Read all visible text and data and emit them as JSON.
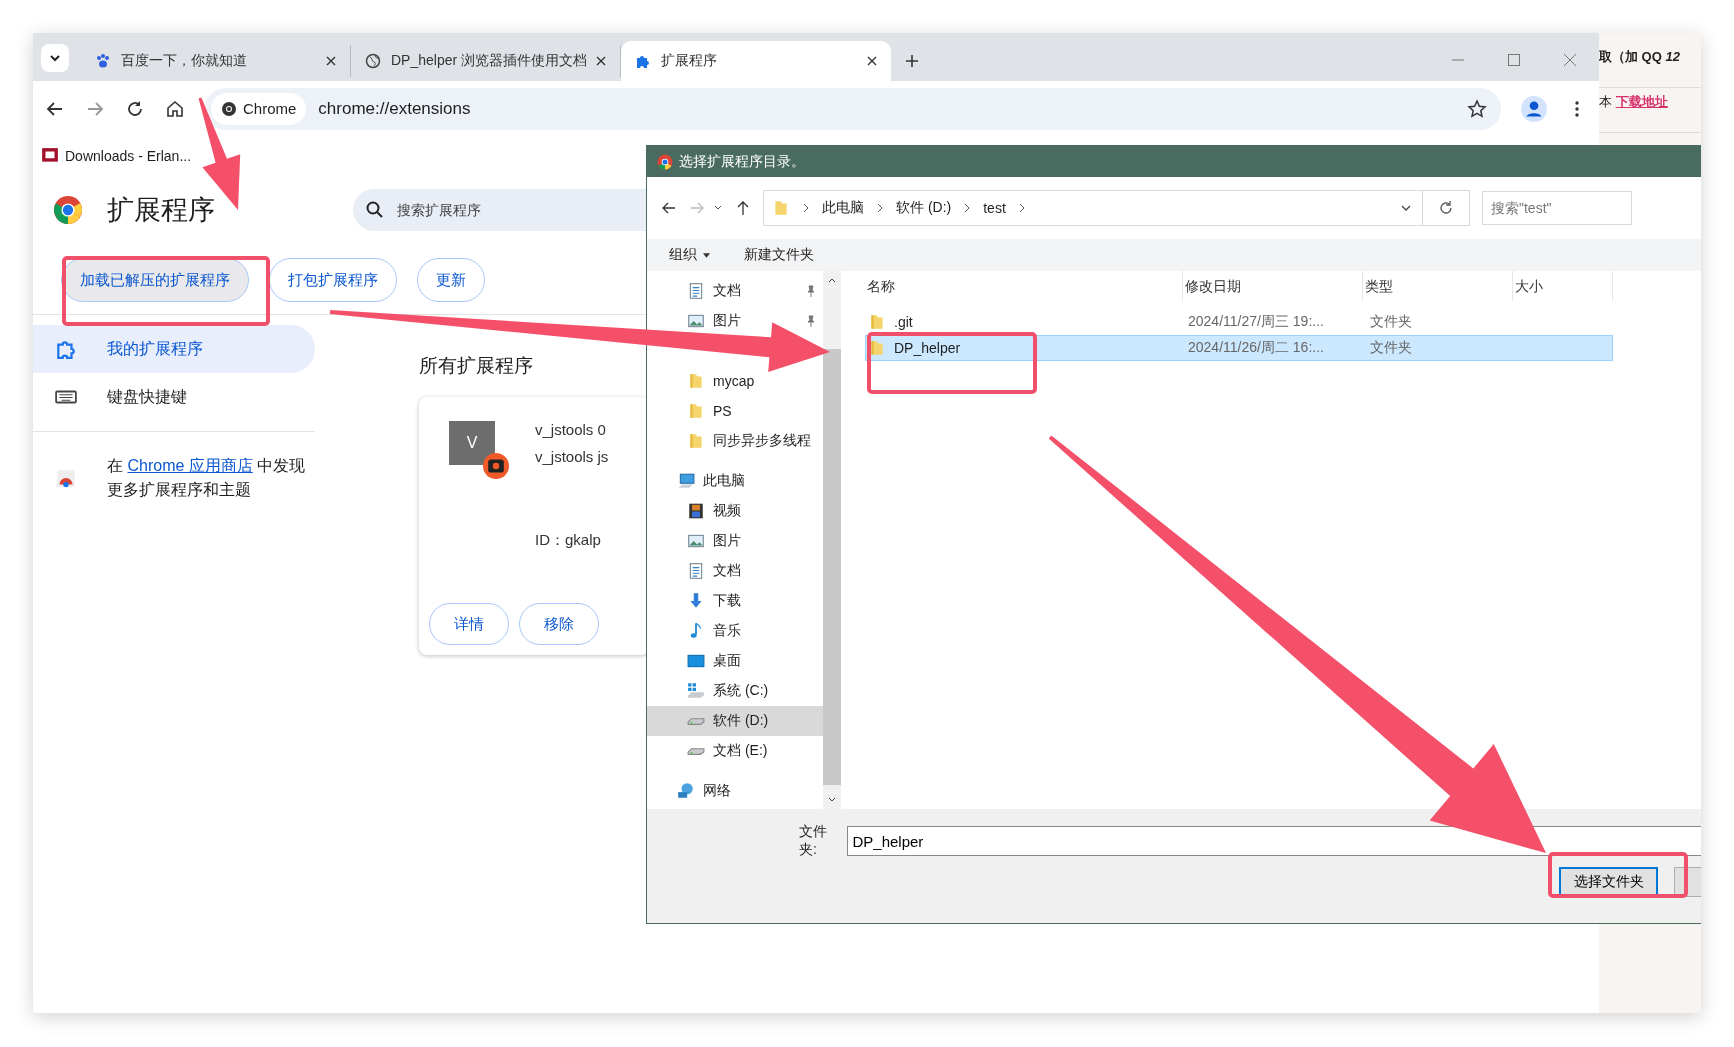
{
  "browser": {
    "tabs": [
      {
        "title": "百度一下，你就知道",
        "kind": "paw",
        "selected": false
      },
      {
        "title": "DP_helper 浏览器插件使用文档",
        "kind": "globe",
        "selected": false
      },
      {
        "title": "扩展程序",
        "kind": "puzzle",
        "selected": true
      }
    ],
    "toolbar": {
      "chip": "Chrome",
      "url": "chrome://extensions"
    },
    "bookmarks": [
      {
        "label": "Downloads - Erlan..."
      }
    ]
  },
  "extensions_page": {
    "title": "扩展程序",
    "search": {
      "placeholder": "搜索扩展程序"
    },
    "actions": [
      {
        "label": "加载已解压的扩展程序",
        "focused": true
      },
      {
        "label": "打包扩展程序",
        "focused": false
      },
      {
        "label": "更新",
        "focused": false
      }
    ],
    "sidebar": {
      "items": [
        {
          "label": "我的扩展程序",
          "kind": "puzzle",
          "selected": true
        },
        {
          "label": "键盘快捷键",
          "kind": "keyboard",
          "selected": false
        }
      ],
      "store_note": {
        "before": "在 ",
        "link": "Chrome 应用商店",
        "after": " 中发现更多扩展程序和主题"
      }
    },
    "section_title": "所有扩展程序",
    "card": {
      "icon_letter": "V",
      "name": "v_jstools 0",
      "description": "v_jstools js",
      "id": "ID：gkalp",
      "buttons": [
        "详情",
        "移除"
      ]
    }
  },
  "background_page": {
    "lines": [
      {
        "text": "取（加 QQ *12*"
      },
      {
        "text": "本 ",
        "link": "下载地址"
      }
    ]
  },
  "dialog": {
    "title": "选择扩展程序目录。",
    "back": {
      "disabled": false
    },
    "forward": {
      "disabled": true
    },
    "breadcrumb": [
      "此电脑",
      "软件 (D:)",
      "test"
    ],
    "search": {
      "placeholder": "搜索\"test\""
    },
    "commands": [
      {
        "label": "组织",
        "dropdown": true
      },
      {
        "label": "新建文件夹",
        "dropdown": false
      }
    ],
    "nav": [
      {
        "label": "文档",
        "kind": "documents",
        "pinned": true,
        "selected": false
      },
      {
        "label": "图片",
        "kind": "pictures",
        "pinned": true,
        "selected": false
      },
      {
        "label": "mycap",
        "kind": "folder",
        "pinned": false,
        "selected": false
      },
      {
        "label": "PS",
        "kind": "folder",
        "pinned": false,
        "selected": false
      },
      {
        "label": "同步异步多线程",
        "kind": "folder",
        "pinned": false,
        "selected": false
      },
      {
        "label": "此电脑",
        "kind": "pc",
        "pinned": false,
        "selected": false,
        "children": [
          {
            "label": "视频",
            "kind": "video",
            "selected": false
          },
          {
            "label": "图片",
            "kind": "pictures",
            "selected": false
          },
          {
            "label": "文档",
            "kind": "documents",
            "selected": false
          },
          {
            "label": "下载",
            "kind": "download",
            "selected": false
          },
          {
            "label": "音乐",
            "kind": "music",
            "selected": false
          },
          {
            "label": "桌面",
            "kind": "desktop",
            "selected": false
          },
          {
            "label": "系统 (C:)",
            "kind": "system-drive",
            "selected": false
          },
          {
            "label": "软件 (D:)",
            "kind": "drive",
            "selected": true
          },
          {
            "label": "文档 (E:)",
            "kind": "drive",
            "selected": false
          }
        ]
      },
      {
        "label": "网络",
        "kind": "network",
        "pinned": false,
        "selected": false
      }
    ],
    "columns": [
      "名称",
      "修改日期",
      "类型",
      "大小"
    ],
    "files": [
      {
        "name": ".git",
        "modified": "2024/11/27/周三 19:...",
        "type": "文件夹",
        "selected": false
      },
      {
        "name": "DP_helper",
        "modified": "2024/11/26/周二 16:...",
        "type": "文件夹",
        "selected": true
      }
    ],
    "folder_field": {
      "label": "文件夹:",
      "value": "DP_helper"
    },
    "buttons": [
      {
        "label": "选择文件夹",
        "focused": true
      }
    ]
  }
}
